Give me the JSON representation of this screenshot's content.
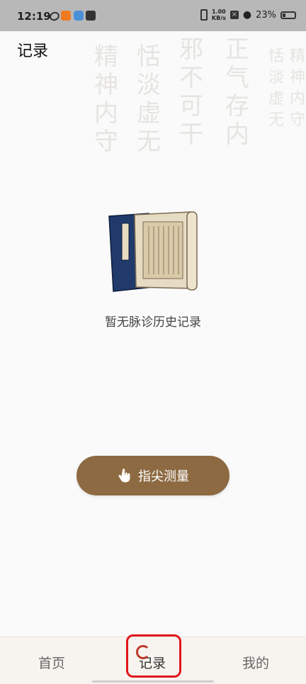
{
  "status_bar": {
    "time": "12:19",
    "speed_value": "1.00",
    "speed_unit": "KB/s",
    "battery": "23%"
  },
  "header": {
    "title": "记录",
    "calligraphy_columns": [
      "正气存内",
      "邪不可干",
      "恬淡虚无",
      "精神内守",
      "恬淡虚无",
      "精神内守"
    ]
  },
  "empty_state": {
    "message": "暂无脉诊历史记录"
  },
  "measure_button": {
    "label": "指尖测量",
    "color": "#8d6a42"
  },
  "bottom_nav": {
    "items": [
      {
        "label": "首页"
      },
      {
        "label": "记录"
      },
      {
        "label": "我的"
      }
    ],
    "active": "记录",
    "highlight_color": "#e0161b"
  }
}
